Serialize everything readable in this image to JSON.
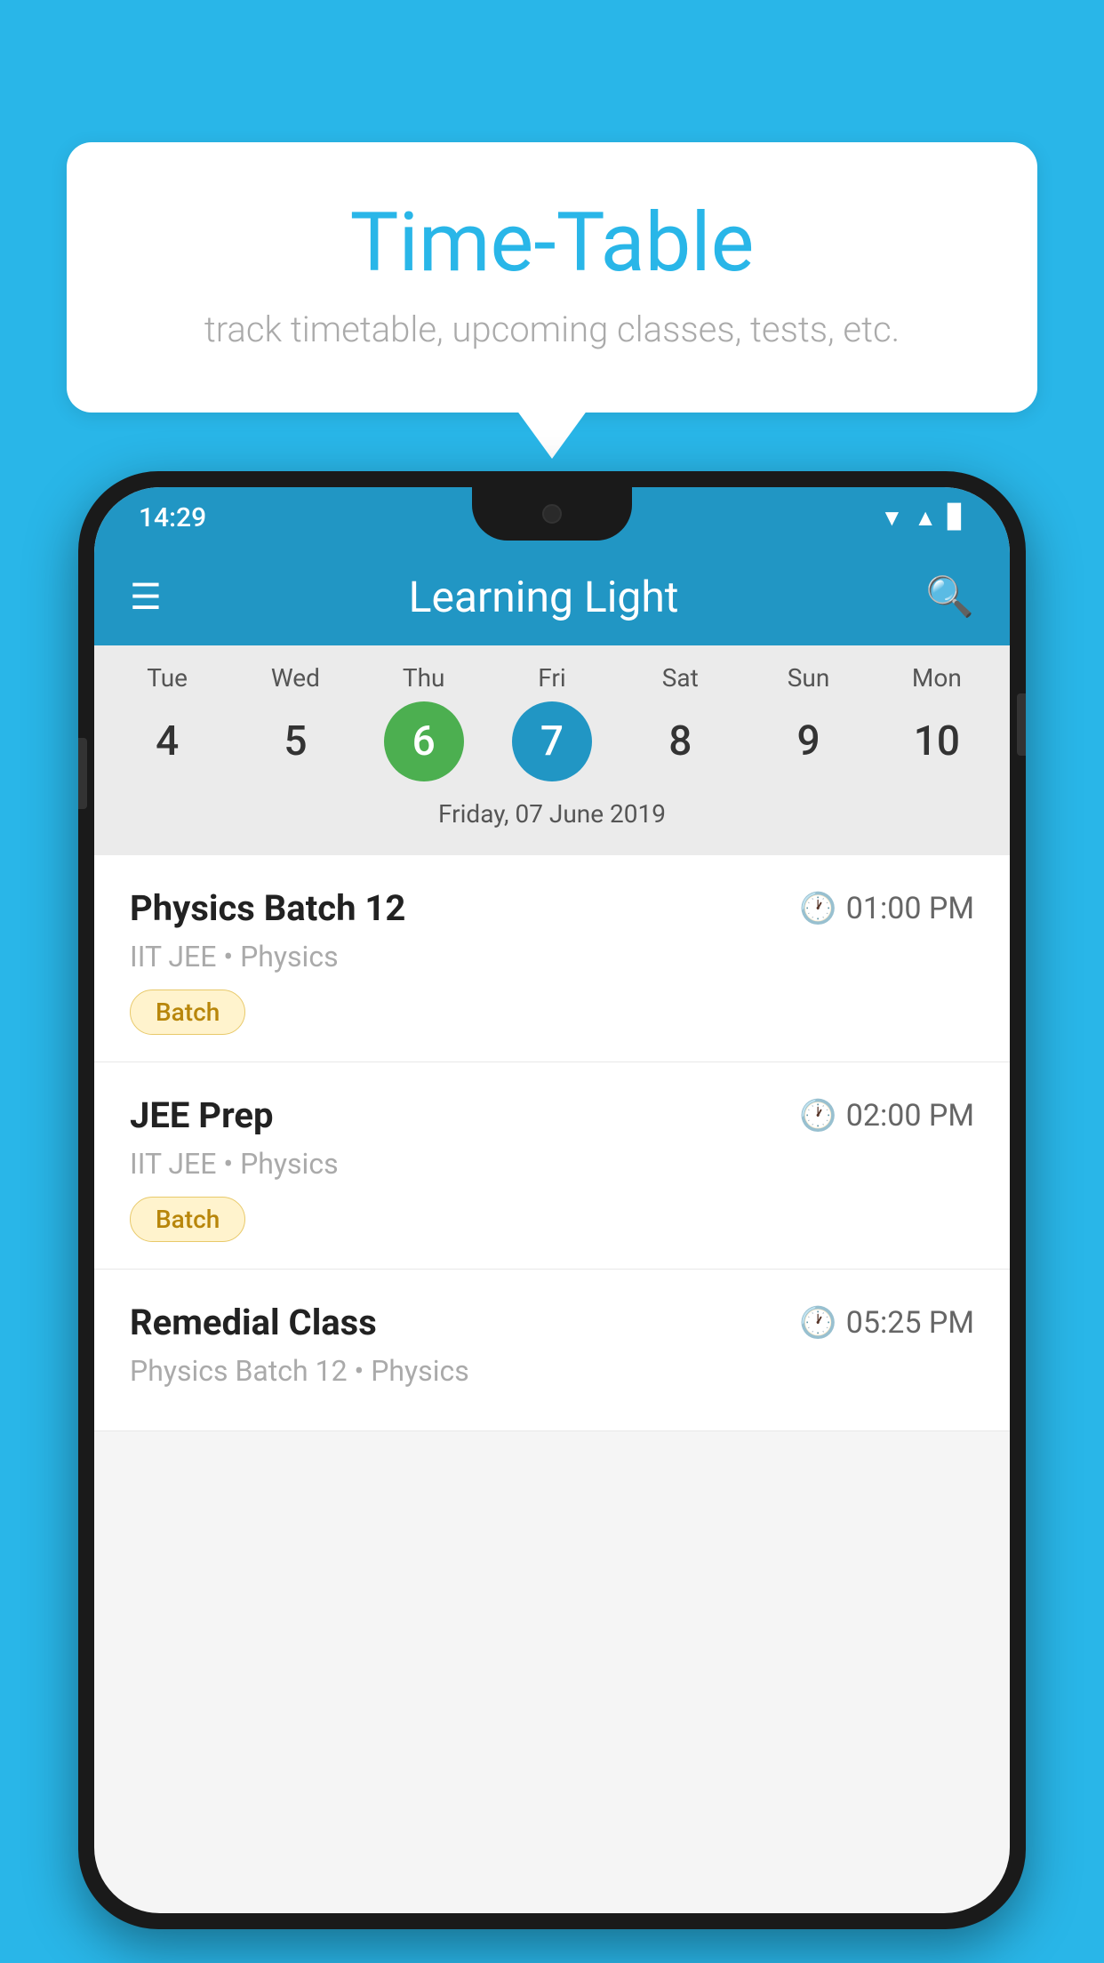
{
  "background_color": "#29b6e8",
  "bubble": {
    "title": "Time-Table",
    "subtitle": "track timetable, upcoming classes, tests, etc."
  },
  "phone": {
    "status_bar": {
      "time": "14:29"
    },
    "app_bar": {
      "title": "Learning Light"
    },
    "calendar": {
      "days": [
        {
          "label": "Tue",
          "number": "4"
        },
        {
          "label": "Wed",
          "number": "5"
        },
        {
          "label": "Thu",
          "number": "6",
          "state": "today"
        },
        {
          "label": "Fri",
          "number": "7",
          "state": "selected"
        },
        {
          "label": "Sat",
          "number": "8"
        },
        {
          "label": "Sun",
          "number": "9"
        },
        {
          "label": "Mon",
          "number": "10"
        }
      ],
      "selected_date": "Friday, 07 June 2019"
    },
    "schedule": [
      {
        "title": "Physics Batch 12",
        "time": "01:00 PM",
        "subtitle": "IIT JEE • Physics",
        "badge": "Batch"
      },
      {
        "title": "JEE Prep",
        "time": "02:00 PM",
        "subtitle": "IIT JEE • Physics",
        "badge": "Batch"
      },
      {
        "title": "Remedial Class",
        "time": "05:25 PM",
        "subtitle": "Physics Batch 12 • Physics",
        "badge": ""
      }
    ]
  }
}
